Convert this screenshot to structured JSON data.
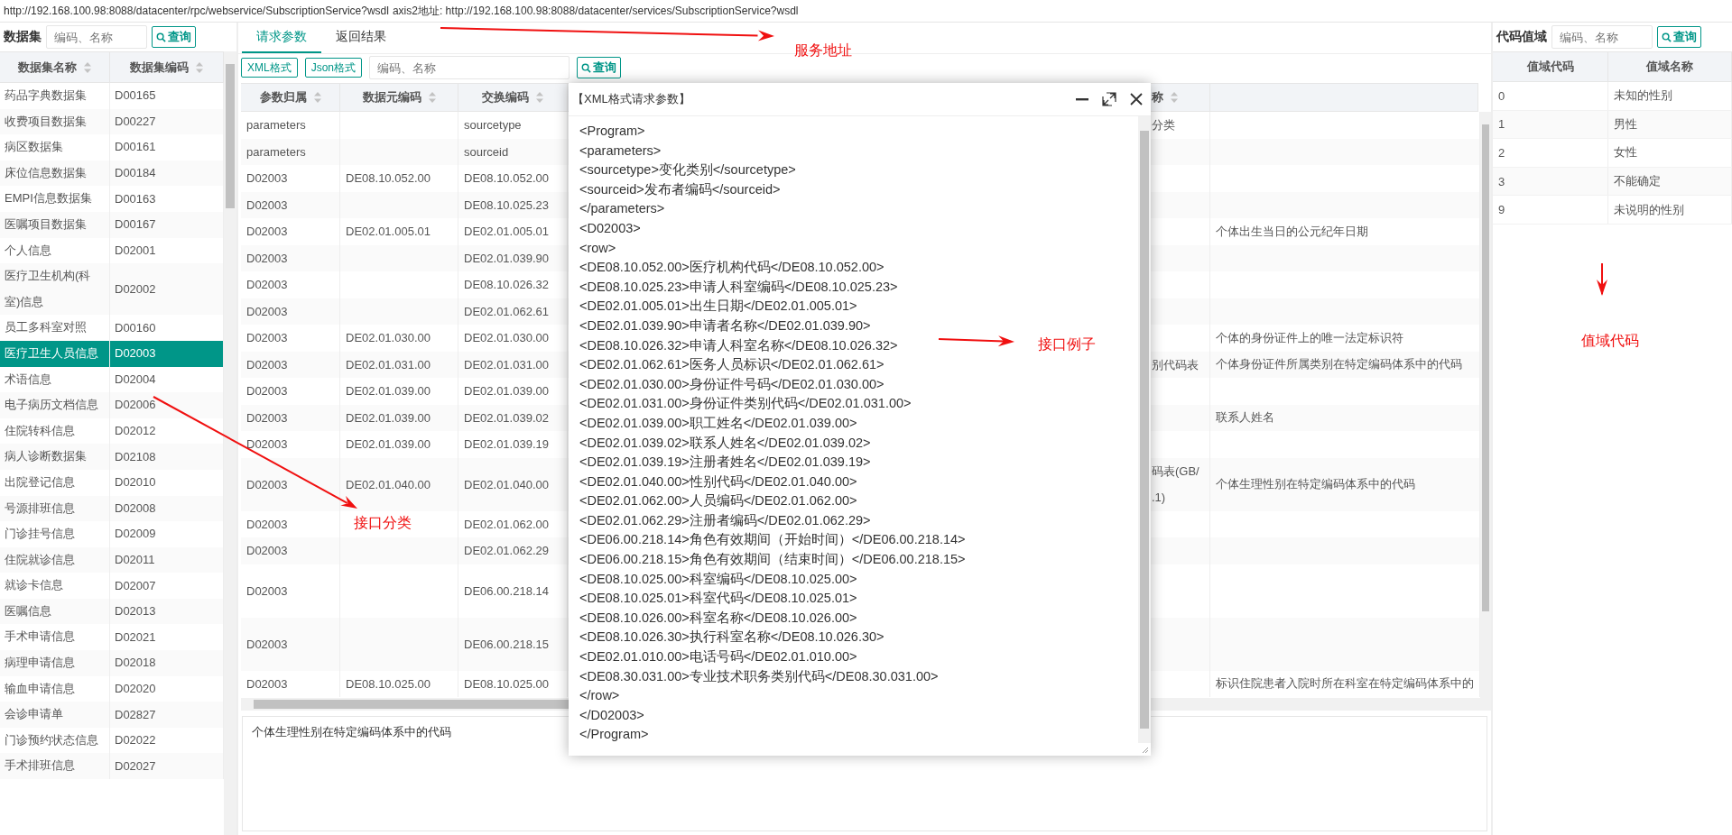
{
  "address_bar": {
    "wsdl_url": "http://192.168.100.98:8088/datacenter/rpc/webservice/SubscriptionService?wsdl",
    "axis2_address": "axis2地址: http://192.168.100.98:8088/datacenter/services/SubscriptionService?wsdl"
  },
  "dataset_panel": {
    "title": "数据集",
    "search": {
      "placeholder": "编码、名称"
    },
    "search_button": "查询",
    "columns": [
      "数据集名称",
      "数据集编码"
    ],
    "rows": [
      {
        "name": "药品字典数据集",
        "code": "D00165",
        "selected": false
      },
      {
        "name": "收费项目数据集",
        "code": "D00227",
        "selected": false
      },
      {
        "name": "病区数据集",
        "code": "D00161",
        "selected": false
      },
      {
        "name": "床位信息数据集",
        "code": "D00184",
        "selected": false
      },
      {
        "name": "EMPI信息数据集",
        "code": "D00163",
        "selected": false
      },
      {
        "name": "医嘱项目数据集",
        "code": "D00167",
        "selected": false
      },
      {
        "name": "个人信息",
        "code": "D02001",
        "selected": false
      },
      {
        "name": "医疗卫生机构(科室)信息",
        "code": "D02002",
        "selected": false
      },
      {
        "name": "员工多科室对照",
        "code": "D00160",
        "selected": false
      },
      {
        "name": "医疗卫生人员信息",
        "code": "D02003",
        "selected": true
      },
      {
        "name": "术语信息",
        "code": "D02004",
        "selected": false
      },
      {
        "name": "电子病历文档信息",
        "code": "D02006",
        "selected": false
      },
      {
        "name": "住院转科信息",
        "code": "D02012",
        "selected": false
      },
      {
        "name": "病人诊断数据集",
        "code": "D02108",
        "selected": false
      },
      {
        "name": "出院登记信息",
        "code": "D02010",
        "selected": false
      },
      {
        "name": "号源排班信息",
        "code": "D02008",
        "selected": false
      },
      {
        "name": "门诊挂号信息",
        "code": "D02009",
        "selected": false
      },
      {
        "name": "住院就诊信息",
        "code": "D02011",
        "selected": false
      },
      {
        "name": "就诊卡信息",
        "code": "D02007",
        "selected": false
      },
      {
        "name": "医嘱信息",
        "code": "D02013",
        "selected": false
      },
      {
        "name": "手术申请信息",
        "code": "D02021",
        "selected": false
      },
      {
        "name": "病理申请信息",
        "code": "D02018",
        "selected": false
      },
      {
        "name": "输血申请信息",
        "code": "D02020",
        "selected": false
      },
      {
        "name": "会诊申请单",
        "code": "D02827",
        "selected": false
      },
      {
        "name": "门诊预约状态信息",
        "code": "D02022",
        "selected": false
      },
      {
        "name": "手术排班信息",
        "code": "D02027",
        "selected": false
      }
    ]
  },
  "params_panel": {
    "tabs": [
      {
        "label": "请求参数",
        "selected": true
      },
      {
        "label": "返回结果",
        "selected": false
      }
    ],
    "format_buttons": [
      "XML格式",
      "Json格式"
    ],
    "search": {
      "placeholder": "编码、名称"
    },
    "search_button": "查询",
    "table": {
      "columns": [
        "参数归属",
        "数据元编码",
        "交换编码",
        "称"
      ],
      "rows": [
        {
          "owner": "parameters",
          "exchange_code": "sourcetype",
          "name": "分类",
          "tall": false
        },
        {
          "owner": "parameters",
          "exchange_code": "sourceid",
          "tall": false
        },
        {
          "owner": "D02003",
          "element_code": "DE08.10.052.00",
          "exchange_code": "DE08.10.052.00",
          "tall": false
        },
        {
          "owner": "D02003",
          "exchange_code": "DE08.10.025.23",
          "tall": false
        },
        {
          "owner": "D02003",
          "element_code": "DE02.01.005.01",
          "exchange_code": "DE02.01.005.01",
          "description": "个体出生当日的公元纪年日期",
          "tall": false
        },
        {
          "owner": "D02003",
          "exchange_code": "DE02.01.039.90",
          "tall": false
        },
        {
          "owner": "D02003",
          "exchange_code": "DE08.10.026.32",
          "tall": false
        },
        {
          "owner": "D02003",
          "exchange_code": "DE02.01.062.61",
          "tall": false
        },
        {
          "owner": "D02003",
          "element_code": "DE02.01.030.00",
          "exchange_code": "DE02.01.030.00",
          "description": "个体的身份证件上的唯一法定标识符",
          "tall": false
        },
        {
          "owner": "D02003",
          "element_code": "DE02.01.031.00",
          "exchange_code": "DE02.01.031.00",
          "name": "别代码表",
          "description": "个体身份证件所属类别在特定编码体系中的代码",
          "tall": false
        },
        {
          "owner": "D02003",
          "element_code": "DE02.01.039.00",
          "exchange_code": "DE02.01.039.00",
          "tall": false
        },
        {
          "owner": "D02003",
          "element_code": "DE02.01.039.00",
          "exchange_code": "DE02.01.039.02",
          "description": "联系人姓名",
          "tall": false
        },
        {
          "owner": "D02003",
          "element_code": "DE02.01.039.00",
          "exchange_code": "DE02.01.039.19",
          "tall": false
        },
        {
          "owner": "D02003",
          "element_code": "DE02.01.040.00",
          "exchange_code": "DE02.01.040.00",
          "name": "码表(GB/\n.1)",
          "description": "个体生理性别在特定编码体系中的代码",
          "tall": true
        },
        {
          "owner": "D02003",
          "exchange_code": "DE02.01.062.00",
          "tall": false
        },
        {
          "owner": "D02003",
          "exchange_code": "DE02.01.062.29",
          "tall": false
        },
        {
          "owner": "D02003",
          "exchange_code": "DE06.00.218.14",
          "tall": true
        },
        {
          "owner": "D02003",
          "exchange_code": "DE06.00.218.15",
          "tall": true
        },
        {
          "owner": "D02003",
          "element_code": "DE08.10.025.00",
          "exchange_code": "DE08.10.025.00",
          "description": "标识住院患者入院时所在科室在特定编码体系中的",
          "tall": false
        }
      ]
    },
    "detail_text": "个体生理性别在特定编码体系中的代码"
  },
  "xml_dialog": {
    "title": "【XML格式请求参数】",
    "lines": [
      "<Program>",
      "<parameters>",
      "<sourcetype>变化类别</sourcetype>",
      "<sourceid>发布者编码</sourceid>",
      "</parameters>",
      "<D02003>",
      "<row>",
      "<DE08.10.052.00>医疗机构代码</DE08.10.052.00>",
      "<DE08.10.025.23>申请人科室编码</DE08.10.025.23>",
      "<DE02.01.005.01>出生日期</DE02.01.005.01>",
      "<DE02.01.039.90>申请者名称</DE02.01.039.90>",
      "<DE08.10.026.32>申请人科室名称</DE08.10.026.32>",
      "<DE02.01.062.61>医务人员标识</DE02.01.062.61>",
      "<DE02.01.030.00>身份证件号码</DE02.01.030.00>",
      "<DE02.01.031.00>身份证件类别代码</DE02.01.031.00>",
      "<DE02.01.039.00>职工姓名</DE02.01.039.00>",
      "<DE02.01.039.02>联系人姓名</DE02.01.039.02>",
      "<DE02.01.039.19>注册者姓名</DE02.01.039.19>",
      "<DE02.01.040.00>性别代码</DE02.01.040.00>",
      "<DE02.01.062.00>人员编码</DE02.01.062.00>",
      "<DE02.01.062.29>注册者编码</DE02.01.062.29>",
      "<DE06.00.218.14>角色有效期间（开始时间）</DE06.00.218.14>",
      "<DE06.00.218.15>角色有效期间（结束时间）</DE06.00.218.15>",
      "<DE08.10.025.00>科室编码</DE08.10.025.00>",
      "<DE08.10.025.01>科室代码</DE08.10.025.01>",
      "<DE08.10.026.00>科室名称</DE08.10.026.00>",
      "<DE08.10.026.30>执行科室名称</DE08.10.026.30>",
      "<DE02.01.010.00>电话号码</DE02.01.010.00>",
      "<DE08.30.031.00>专业技术职务类别代码</DE08.30.031.00>",
      "</row>",
      "</D02003>",
      "</Program>"
    ]
  },
  "code_domain_panel": {
    "title": "代码值域",
    "search": {
      "placeholder": "编码、名称"
    },
    "search_button": "查询",
    "columns": [
      "值域代码",
      "值域名称"
    ],
    "rows": [
      {
        "code": "0",
        "name": "未知的性别"
      },
      {
        "code": "1",
        "name": "男性"
      },
      {
        "code": "2",
        "name": "女性"
      },
      {
        "code": "3",
        "name": "不能确定"
      },
      {
        "code": "9",
        "name": "未说明的性别"
      }
    ]
  },
  "annotations": [
    {
      "text": "服务地址"
    },
    {
      "text": "接口分类"
    },
    {
      "text": "接口例子"
    },
    {
      "text": "值域代码"
    }
  ]
}
